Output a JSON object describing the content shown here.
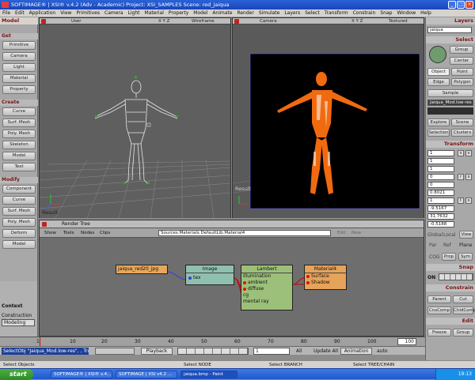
{
  "window": {
    "title": "SOFTIMAGE® | XSI® v.4.2 (Adv - Academic) Project: XSI_SAMPLES    Scene: red_jaiqua"
  },
  "menu": [
    "File",
    "Edit",
    "Application",
    "View",
    "Primitives",
    "Camera",
    "Light",
    "Material",
    "Property",
    "Model",
    "Animate",
    "Render",
    "Simulate",
    "Layers",
    "Select",
    "Transform",
    "Constrain",
    "Snap",
    "Window",
    "Help"
  ],
  "left": {
    "module": "Model",
    "get": {
      "header": "Get",
      "items": [
        "Primitive",
        "Camera",
        "Light",
        "Material",
        "Property"
      ]
    },
    "create": {
      "header": "Create",
      "items": [
        "Curve",
        "Surf. Mesh",
        "Poly. Mesh",
        "Skeleton",
        "Model",
        "Text"
      ]
    },
    "modify": {
      "header": "Modify",
      "items": [
        "Component",
        "Curve",
        "Surf. Mesh",
        "Poly. Mesh",
        "Deform",
        "Model"
      ]
    }
  },
  "viewports": {
    "left": {
      "name": "User",
      "axes": "X Y Z",
      "mode": "Wireframe",
      "label": "Result"
    },
    "right": {
      "name": "Camera",
      "axes": "X Y Z",
      "mode": "Textured",
      "label": "Result"
    }
  },
  "right": {
    "layers": "Layers",
    "layer_field": "jaiqua",
    "select": "Select",
    "group": "Group",
    "center": "Center",
    "object": "Object",
    "point": "Point",
    "edge": "Edge",
    "polygon": "Polygon",
    "sample": "Sample",
    "selection_name": "Jaiqua_Mod.low-res",
    "explore": "Explore",
    "scene": "Scene",
    "selection": "Selection",
    "clusters": "Clusters",
    "transform": "Transform",
    "fields": [
      "1",
      "1",
      "1",
      "0",
      "0",
      "0.8021",
      "1",
      "-9.5167",
      "31.7632",
      "-0.5188"
    ],
    "global": "Global",
    "local": "Local",
    "view": "View",
    "par": "Par",
    "ref": "Ref",
    "plane": "Plane",
    "cog": "COG",
    "prop": "Prop",
    "sym": "Sym",
    "snap": "Snap",
    "snap_on": "ON",
    "constrain": "Constrain",
    "parent": "Parent",
    "cut": "Cut",
    "cnscomp": "CnsComp",
    "chldcomp": "ChldComp",
    "edit": "Edit",
    "freeze": "Freeze",
    "group2": "Group"
  },
  "rendertree": {
    "title": "Render Tree",
    "toolbar": {
      "show": "Show",
      "tools": "Tools",
      "nodes": "Nodes",
      "clips": "Clips",
      "path": "Sources.Materials.DefaultLib.Material4",
      "edit": "Edit",
      "new": "New"
    },
    "nodes": {
      "tex": {
        "title": "jaiqua_red20_jpg"
      },
      "image": {
        "title": "Image",
        "port": "tex"
      },
      "lambert": {
        "title": "Lambert",
        "ports": [
          "Illumination",
          "ambient",
          "diffuse",
          "cg",
          "mental ray"
        ]
      },
      "material": {
        "title": "Material4",
        "ports": [
          "Surface",
          "Shadow"
        ]
      }
    }
  },
  "context": {
    "header": "Context",
    "mode_label": "Construction Mode",
    "mode_value": "Modeling"
  },
  "timeline": {
    "ticks": [
      "1",
      "10",
      "20",
      "30",
      "40",
      "50",
      "60",
      "70",
      "80",
      "90",
      "100"
    ],
    "end": "100"
  },
  "command": {
    "text": "SelectObj \"Jaiqua_Mod.low-res\", , True"
  },
  "playback": {
    "frame": "1",
    "playback": "Playback",
    "all": "All",
    "update": "Update All",
    "animation": "Animation",
    "auto": "auto"
  },
  "status": {
    "select_objects": "Select Objects",
    "select_node": "Select NODE",
    "select_branch": "Select BRANCH",
    "select_tree": "Select TREE/CHAIN"
  },
  "taskbar": {
    "start": "start",
    "tasks": [
      "SOFTIMAGE® | XSI® v.4...",
      "SOFTIMAGE | XSI v4.2 ...",
      "jaiqua.bmp - Paint"
    ],
    "clock": "19:13"
  }
}
